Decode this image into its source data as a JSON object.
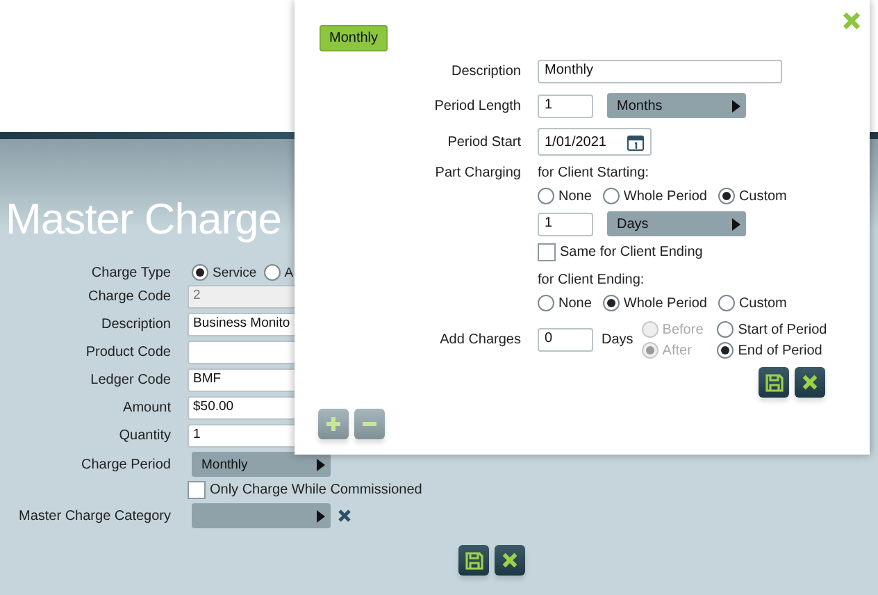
{
  "page": {
    "title": "Master Charge"
  },
  "fields": [
    {
      "kind": "radio",
      "label": "Charge Type",
      "options": [
        {
          "label": "Service",
          "selected": true
        },
        {
          "label": "A",
          "selected": false
        }
      ]
    },
    {
      "kind": "text",
      "label": "Charge Code",
      "value": "2",
      "disabled": true
    },
    {
      "kind": "text",
      "label": "Description",
      "value": "Business Monito",
      "disabled": false
    },
    {
      "kind": "text",
      "label": "Product Code",
      "disabled": false
    },
    {
      "kind": "text",
      "label": "Ledger Code",
      "value": "BMF",
      "disabled": false
    },
    {
      "kind": "text",
      "label": "Amount",
      "value": "$50.00",
      "disabled": false
    },
    {
      "kind": "text",
      "label": "Quantity",
      "value": "1",
      "disabled": false
    },
    {
      "kind": "select",
      "label": "Charge Period",
      "value": "Monthly"
    },
    {
      "kind": "checkbox",
      "text": "Only Charge While Commissioned",
      "checked": false
    },
    {
      "kind": "select",
      "label": "Master Charge Category",
      "clearable": true
    }
  ],
  "dialog": {
    "tag": "Monthly",
    "description": {
      "label": "Description",
      "value": "Monthly"
    },
    "period_length": {
      "label": "Period Length",
      "value": "1",
      "unit": "Months"
    },
    "period_start": {
      "label": "Period Start",
      "value": "1/01/2021"
    },
    "part_charging": {
      "label": "Part Charging",
      "starting": {
        "heading": "for Client Starting:",
        "options": [
          {
            "label": "None",
            "selected": false
          },
          {
            "label": "Whole Period",
            "selected": false
          },
          {
            "label": "Custom",
            "selected": true
          }
        ],
        "amount": "1",
        "unit": "Days",
        "same_for_ending": {
          "label": "Same for Client Ending",
          "checked": false
        }
      },
      "ending": {
        "heading": "for Client Ending:",
        "options": [
          {
            "label": "None",
            "selected": false
          },
          {
            "label": "Whole Period",
            "selected": true
          },
          {
            "label": "Custom",
            "selected": false
          }
        ]
      }
    },
    "add_charges": {
      "label": "Add Charges",
      "value": "0",
      "unit": "Days",
      "direction": [
        {
          "label": "Before",
          "selected": false,
          "disabled": true
        },
        {
          "label": "After",
          "selected": true,
          "disabled": true
        }
      ],
      "anchor": [
        {
          "label": "Start of Period",
          "selected": false
        },
        {
          "label": "End of Period",
          "selected": true
        }
      ]
    }
  }
}
